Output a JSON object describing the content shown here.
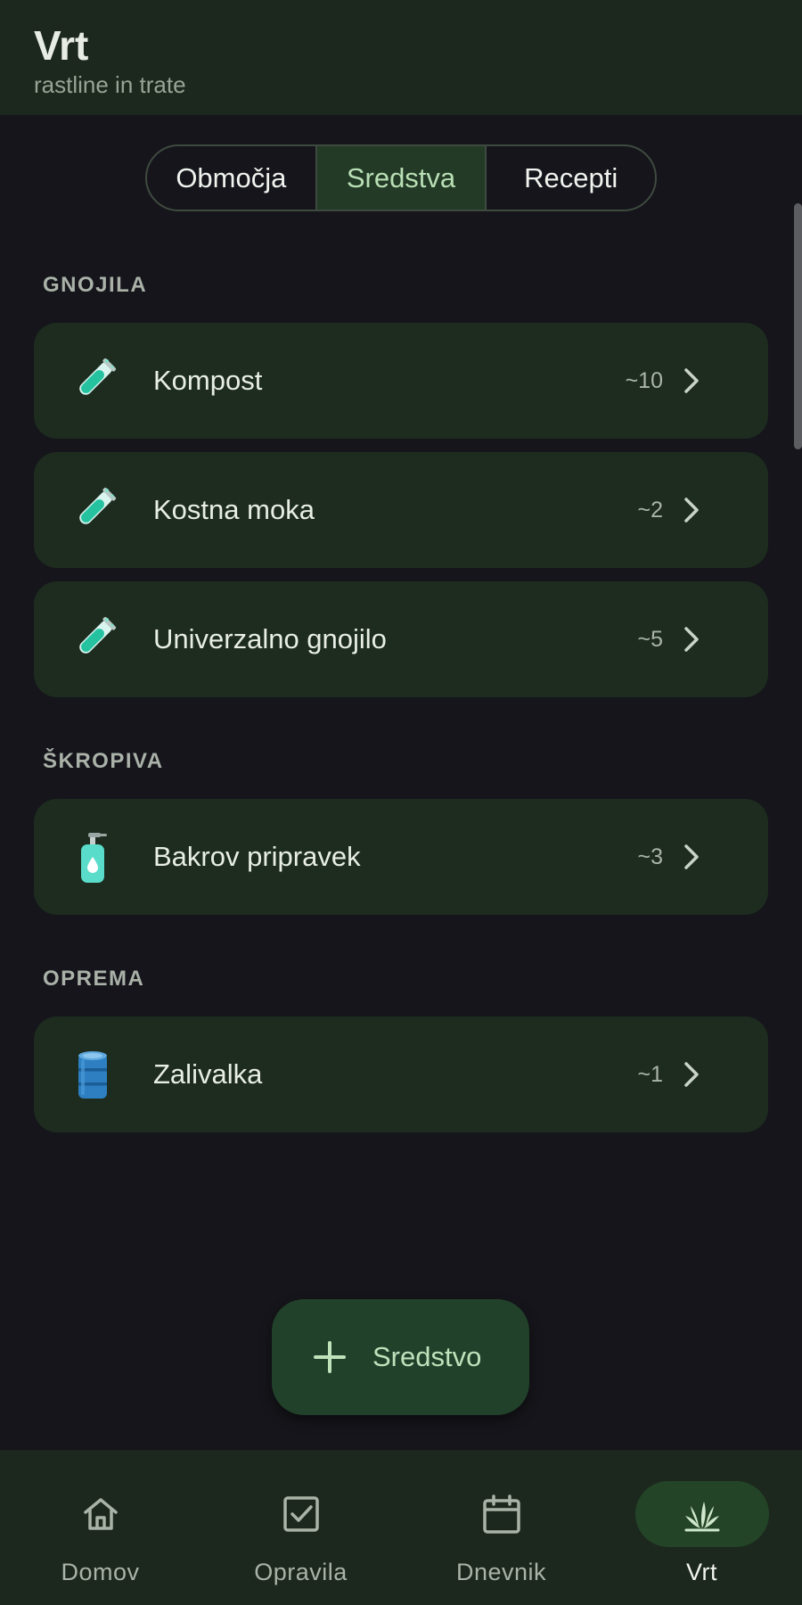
{
  "header": {
    "title": "Vrt",
    "subtitle": "rastline in trate"
  },
  "tabs": [
    {
      "label": "Območja",
      "active": false
    },
    {
      "label": "Sredstva",
      "active": true
    },
    {
      "label": "Recepti",
      "active": false
    }
  ],
  "sections": [
    {
      "label": "GNOJILA",
      "items": [
        {
          "name": "Kompost",
          "count": "~10",
          "icon": "test-tube-icon"
        },
        {
          "name": "Kostna moka",
          "count": "~2",
          "icon": "test-tube-icon"
        },
        {
          "name": "Univerzalno gnojilo",
          "count": "~5",
          "icon": "test-tube-icon"
        }
      ]
    },
    {
      "label": "ŠKROPIVA",
      "items": [
        {
          "name": "Bakrov pripravek",
          "count": "~3",
          "icon": "spray-bottle-icon"
        }
      ]
    },
    {
      "label": "OPREMA",
      "items": [
        {
          "name": "Zalivalka",
          "count": "~1",
          "icon": "barrel-icon"
        }
      ]
    }
  ],
  "fab": {
    "label": "Sredstvo",
    "icon": "plus-icon"
  },
  "nav": [
    {
      "label": "Domov",
      "icon": "home-icon",
      "active": false
    },
    {
      "label": "Opravila",
      "icon": "checkbox-icon",
      "active": false
    },
    {
      "label": "Dnevnik",
      "icon": "calendar-icon",
      "active": false
    },
    {
      "label": "Vrt",
      "icon": "plant-icon",
      "active": true
    }
  ],
  "colors": {
    "background": "#15151b",
    "surface": "#1d2c1f",
    "header": "#1c281d",
    "accent": "#b9dfb5",
    "active_pill": "#244428"
  }
}
